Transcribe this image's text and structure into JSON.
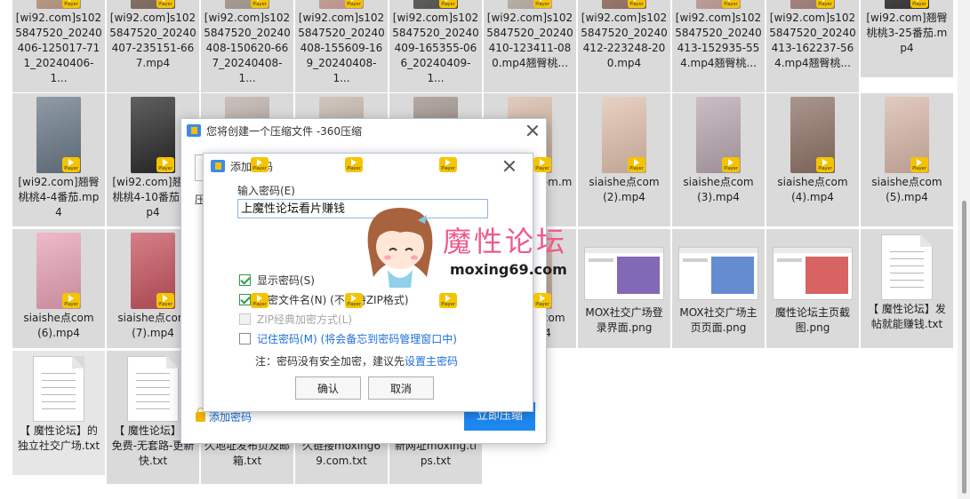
{
  "files": [
    {
      "name": "[wi92.com]s1025847520_20240406-125017-711_20240406-1...",
      "type": "video",
      "thumb": "#c9a38d"
    },
    {
      "name": "[wi92.com]s1025847520_20240407-235151-667.mp4",
      "type": "video",
      "thumb": "#8b7466"
    },
    {
      "name": "[wi92.com]s1025847520_20240408-150620-667_20240408-1...",
      "type": "video",
      "thumb": "#b6a99c"
    },
    {
      "name": "[wi92.com]s1025847520_20240408-155609-169_20240408-1...",
      "type": "video",
      "thumb": "#d6a8a0"
    },
    {
      "name": "[wi92.com]s1025847520_20240409-165355-066_20240409-1...",
      "type": "video",
      "thumb": "#5f5d5a"
    },
    {
      "name": "[wi92.com]s1025847520_20240410-123411-080.mp4翘臀桃...",
      "type": "video",
      "thumb": "#c8bfb4"
    },
    {
      "name": "[wi92.com]s1025847520_20240412-223248-200.mp4",
      "type": "video",
      "thumb": "#a37b6e"
    },
    {
      "name": "[wi92.com]s1025847520_20240413-152935-554.mp4翘臀桃...",
      "type": "video",
      "thumb": "#cfa9a2"
    },
    {
      "name": "[wi92.com]s1025847520_20240413-162237-564.mp4翘臀桃...",
      "type": "video",
      "thumb": "#b08b82"
    },
    {
      "name": "[wi92.com]翘臀桃桃3-25番茄.mp4",
      "type": "video",
      "thumb": "#3e3b3b"
    },
    {
      "name": "[wi92.com]翘臀桃桃4-4番茄.mp4",
      "type": "video",
      "thumb": "#6a7a88"
    },
    {
      "name": "[wi92.com]翘臀桃桃4-10番茄.mp4",
      "type": "video",
      "thumb": "#2c2a2a"
    },
    {
      "name": "",
      "type": "video",
      "thumb": "#b8aca6"
    },
    {
      "name": "",
      "type": "video",
      "thumb": "#c0b3a8"
    },
    {
      "name": "",
      "type": "video",
      "thumb": "#9b8d86"
    },
    {
      "name": "siaishe点com.mp4",
      "type": "video",
      "thumb": "#d8b9a6"
    },
    {
      "name": "siaishe点com(2).mp4",
      "type": "video",
      "thumb": "#e1c1ae"
    },
    {
      "name": "siaishe点com(3).mp4",
      "type": "video",
      "thumb": "#b9a8b0"
    },
    {
      "name": "siaishe点com(4).mp4",
      "type": "video",
      "thumb": "#8f7367"
    },
    {
      "name": "siaishe点com(5).mp4",
      "type": "video",
      "thumb": "#d9b8aa"
    },
    {
      "name": "siaishe点com(6).mp4",
      "type": "video",
      "thumb": "#e8a3b6"
    },
    {
      "name": "siaishe点com(7).mp4",
      "type": "video",
      "thumb": "#c7545f"
    },
    {
      "name": "",
      "type": "video",
      "thumb": "#cbb9ae"
    },
    {
      "name": "",
      "type": "video",
      "thumb": "#b09a8d"
    },
    {
      "name": "",
      "type": "video",
      "thumb": "#c2b4aa"
    },
    {
      "name": "siaishe点com(8).mp4",
      "type": "video",
      "thumb": "#d4b3a5"
    },
    {
      "name": "MOX社交广场登录界面.png",
      "type": "image",
      "thumb": "#6c4fa8"
    },
    {
      "name": "MOX社交广场主页页面.png",
      "type": "image",
      "thumb": "#4a78c8"
    },
    {
      "name": "魔性论坛主页截图.png",
      "type": "image",
      "thumb": "#d04848"
    },
    {
      "name": "【 魔性论坛】发帖就能赚钱.txt",
      "type": "text",
      "thumb": "#ffffff"
    },
    {
      "name": "【 魔性论坛】的独立社交广场.txt",
      "type": "text",
      "thumb": "#ffffff"
    },
    {
      "name": "【 魔性论坛】全免费-无套路-更新快.txt",
      "type": "text",
      "thumb": "#ffffff"
    },
    {
      "name": "【 魔性论坛】永久地址发布页及邮箱.txt",
      "type": "text",
      "thumb": "#ffffff"
    },
    {
      "name": "【 魔性论坛】永久链接moxing69.com.txt",
      "type": "text",
      "thumb": "#ffffff"
    },
    {
      "name": "【 魔性论坛】最新网址moxing.tips.txt",
      "type": "text",
      "thumb": "#ffffff"
    }
  ],
  "player_badge_label": "Player",
  "compress_dialog": {
    "title": "您将创建一个压缩文件 -360压缩",
    "label_partial": "压",
    "add_password_link": "添加密码",
    "start_button": "立即压缩"
  },
  "password_dialog": {
    "title": "添加密码",
    "input_label": "输入密码(E)",
    "password_value": "上魔性论坛看片赚钱",
    "options": [
      {
        "label": "显示密码(S)",
        "checked": true,
        "disabled": false
      },
      {
        "label": "加密文件名(N) (不支持ZIP格式)",
        "checked": true,
        "disabled": false
      },
      {
        "label": "ZIP经典加密方式(L)",
        "checked": false,
        "disabled": true
      },
      {
        "label": "记住密码(M) (将会备忘到密码管理窗口中)",
        "checked": false,
        "disabled": false
      }
    ],
    "note_text": "注：密码没有安全加密，建议先",
    "note_link": "设置主密码",
    "ok_button": "确认",
    "cancel_button": "取消"
  },
  "watermark": {
    "title": "魔性论坛",
    "url": "moxing69.com"
  }
}
